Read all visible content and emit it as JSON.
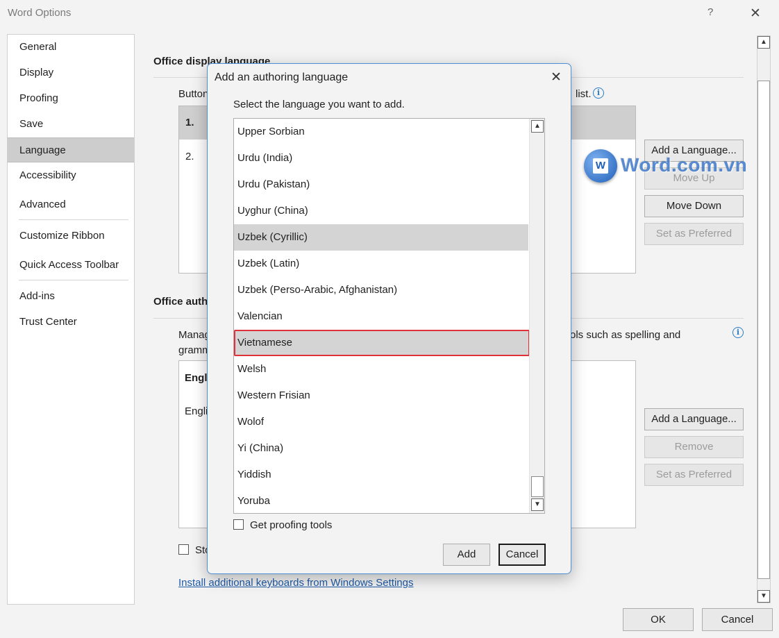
{
  "window": {
    "title": "Word Options",
    "help_label": "?",
    "close_label": "✕"
  },
  "nav": {
    "items": [
      "General",
      "Display",
      "Proofing",
      "Save",
      "Language",
      "Accessibility",
      "Advanced",
      "Customize Ribbon",
      "Quick Access Toolbar",
      "Add-ins",
      "Trust Center"
    ],
    "selected": "Language"
  },
  "display_language": {
    "heading": "Office display language",
    "desc_start": "Button",
    "desc_end": "list.",
    "rows": [
      "1.",
      "2."
    ],
    "buttons": {
      "add": "Add a Language...",
      "move_up": "Move Up",
      "move_down": "Move Down",
      "set_preferred": "Set as Preferred"
    }
  },
  "authoring_languages": {
    "heading": "Office auth",
    "desc_line1_start": "Manag",
    "desc_line1_end": "ols such as spelling and",
    "desc_line2_start": "gramm",
    "list_heading": "Engl",
    "list_item": "Engli",
    "buttons": {
      "add": "Add a Language...",
      "remove": "Remove",
      "set_preferred": "Set as Preferred"
    }
  },
  "stop_checkbox_label": "Sto",
  "install_keyboards_link": "Install additional keyboards from Windows Settings",
  "footer": {
    "ok": "OK",
    "cancel": "Cancel"
  },
  "watermark": {
    "text": "Word.com.vn"
  },
  "modal": {
    "title": "Add an authoring language",
    "prompt": "Select the language you want to add.",
    "languages": [
      "Upper Sorbian",
      "Urdu (India)",
      "Urdu (Pakistan)",
      "Uyghur (China)",
      "Uzbek (Cyrillic)",
      "Uzbek (Latin)",
      "Uzbek (Perso-Arabic, Afghanistan)",
      "Valencian",
      "Vietnamese",
      "Welsh",
      "Western Frisian",
      "Wolof",
      "Yi (China)",
      "Yiddish",
      "Yoruba"
    ],
    "hover_item": "Uzbek (Cyrillic)",
    "selected_item": "Vietnamese",
    "proofing_checkbox_label": "Get proofing tools",
    "proofing_checked": false,
    "add_button": "Add",
    "cancel_button": "Cancel",
    "highlight_color": "#e0313a"
  }
}
